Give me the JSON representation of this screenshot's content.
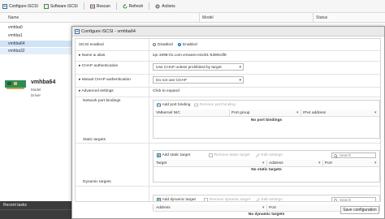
{
  "toolbar": {
    "configure_iscsi": "Configure iSCSI",
    "software_iscsi": "Software iSCSI",
    "rescan": "Rescan",
    "refresh": "Refresh",
    "actions": "Actions"
  },
  "grid": {
    "col_name": "Name",
    "col_model": "Model",
    "col_status": "Status",
    "rows": [
      "vmhba0",
      "vmhba1",
      "vmhba64",
      "vmhba32"
    ]
  },
  "detail": {
    "title": "vmhba64",
    "model_label": "Model",
    "driver_label": "Driver"
  },
  "bottom": {
    "recent_tasks": "Recent tasks"
  },
  "modal": {
    "title": "Configure iSCSI - vmhba64",
    "iscsi_enabled_label": "iSCSI enabled",
    "disabled_label": "Disabled",
    "enabled_label": "Enabled",
    "name_alias_label": "Name & alias",
    "name_value": "iqn.1998-01.com.vmware:esxi01-5390e3f8",
    "chap_auth_label": "CHAP authentication",
    "chap_auth_value": "Use CHAP unless prohibited by target",
    "mutual_chap_label": "Mutual CHAP authentication",
    "mutual_chap_value": "Do not use CHAP",
    "advanced_label": "Advanced settings",
    "advanced_value": "Click to expand",
    "port_bindings": {
      "label": "Network port bindings",
      "add": "Add port binding",
      "remove": "Remove port binding",
      "columns": [
        "VMkernel NIC",
        "Port group",
        "IPv4 address"
      ],
      "empty": "No port bindings"
    },
    "static_targets": {
      "label": "Static targets",
      "add": "Add static target",
      "remove": "Remove static target",
      "edit": "Edit settings",
      "search_placeholder": "Search",
      "columns": [
        "Target",
        "Address",
        "Port"
      ],
      "empty": "No static targets"
    },
    "dynamic_targets": {
      "label": "Dynamic targets",
      "add": "Add dynamic target",
      "remove": "Remove dynamic target",
      "edit": "Edit settings",
      "search_placeholder": "Search",
      "columns": [
        "Address",
        "Port"
      ],
      "empty": "No dynamic targets"
    },
    "save_button": "Save configuration"
  },
  "colors": {
    "accent": "#0070c0",
    "selection": "#cfe3f5",
    "add_icon": "#3a9b3a"
  }
}
